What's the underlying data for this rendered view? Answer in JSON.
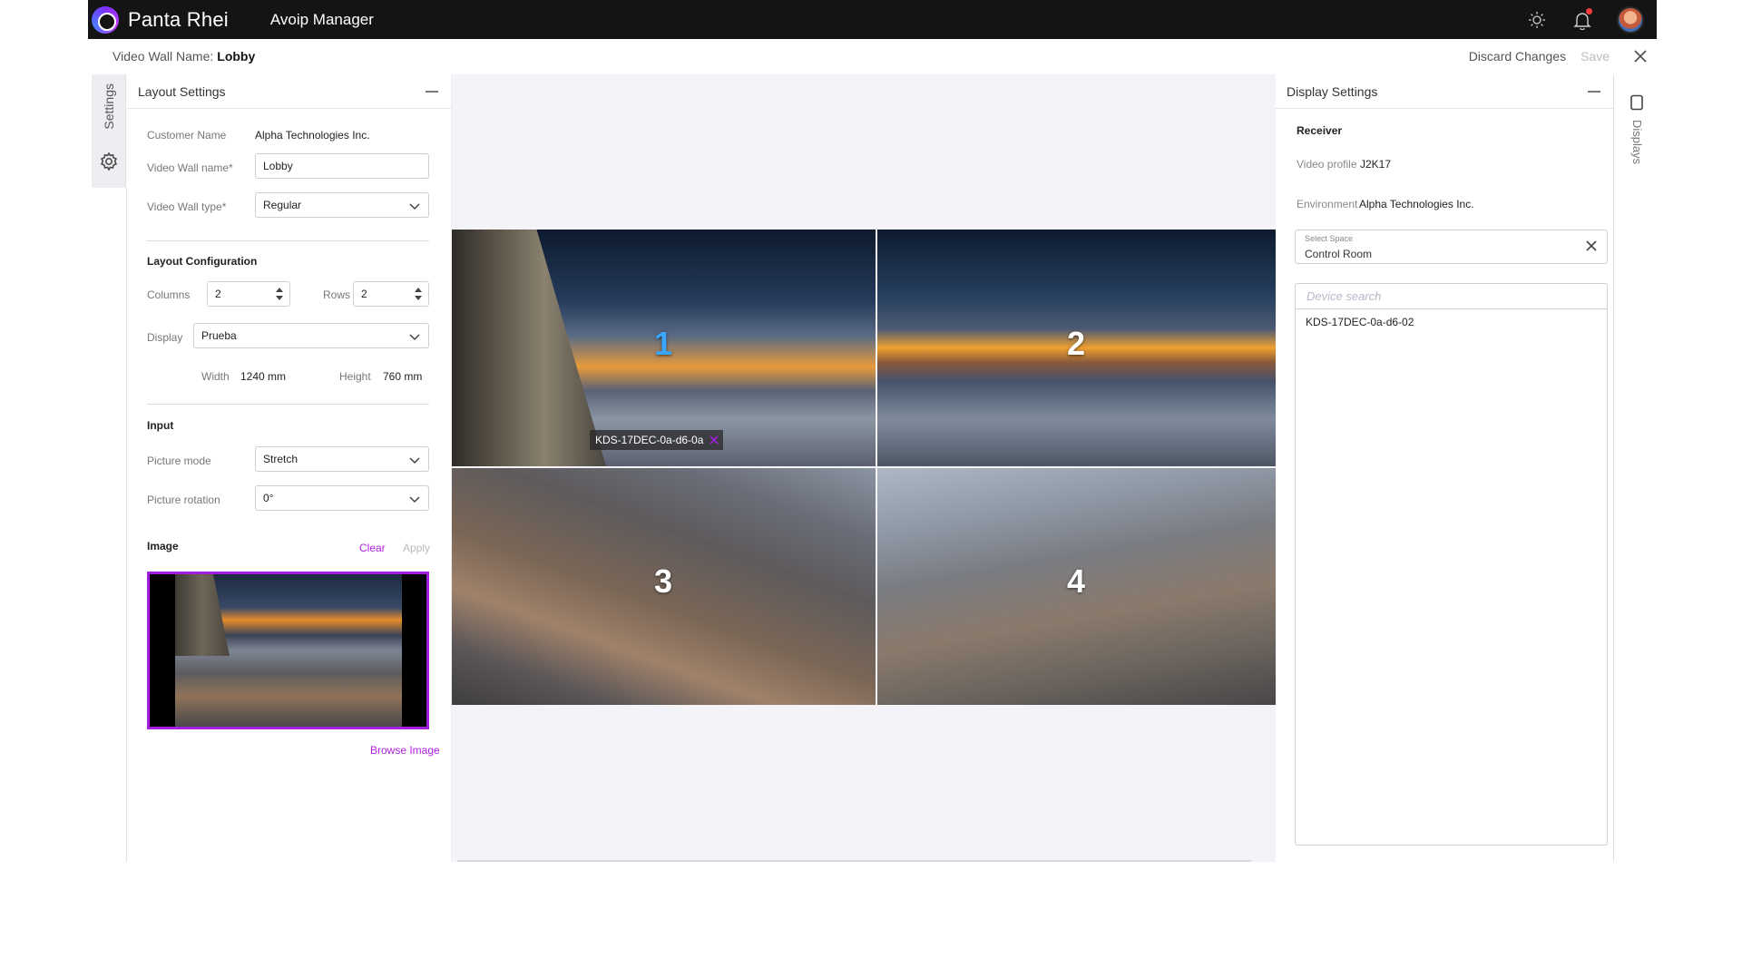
{
  "topbar": {
    "brand": "Panta Rhei",
    "app_name": "Avoip Manager"
  },
  "subheader": {
    "label": "Video Wall Name:",
    "value": "Lobby",
    "discard": "Discard Changes",
    "save": "Save"
  },
  "left_tab": {
    "label": "Settings"
  },
  "layout_settings": {
    "title": "Layout Settings",
    "customer_name_label": "Customer Name",
    "customer_name_value": "Alpha Technologies Inc.",
    "wall_name_label": "Video Wall name*",
    "wall_name_value": "Lobby",
    "wall_type_label": "Video Wall type*",
    "wall_type_value": "Regular",
    "layout_config_title": "Layout Configuration",
    "columns_label": "Columns",
    "columns_value": "2",
    "rows_label": "Rows",
    "rows_value": "2",
    "display_label": "Display",
    "display_value": "Prueba",
    "width_label": "Width",
    "width_value": "1240 mm",
    "height_label": "Height",
    "height_value": "760 mm",
    "input_title": "Input",
    "picture_mode_label": "Picture mode",
    "picture_mode_value": "Stretch",
    "picture_rotation_label": "Picture rotation",
    "picture_rotation_value": "0°",
    "image_title": "Image",
    "clear": "Clear",
    "apply": "Apply",
    "browse": "Browse Image"
  },
  "canvas": {
    "tiles": [
      "1",
      "2",
      "3",
      "4"
    ],
    "selected_tile": "1",
    "device_chip": "KDS-17DEC-0a-d6-0a"
  },
  "display_settings": {
    "title": "Display Settings",
    "receiver": "Receiver",
    "video_profile_label": "Video profile",
    "video_profile_value": "J2K17",
    "environment_label": "Environment",
    "environment_value": "Alpha Technologies Inc.",
    "select_space_label": "Select Space",
    "select_space_value": "Control Room",
    "device_search_placeholder": "Device search",
    "devices": [
      "KDS-17DEC-0a-d6-02"
    ]
  },
  "right_tab": {
    "label": "Displays"
  },
  "colors": {
    "topbar": "#141414",
    "accent_purple": "#a21fe0",
    "selected_tile_number": "#3ba6ff",
    "canvas_bg": "#f4f4f8"
  },
  "icons": {
    "theme": "sun-icon",
    "notifications": "bell-icon",
    "user": "avatar",
    "close": "close-icon",
    "settings": "gear-icon",
    "displays": "display-icon",
    "dropdown": "chevron-down-icon",
    "stepper": "stepper-arrows-icon"
  }
}
